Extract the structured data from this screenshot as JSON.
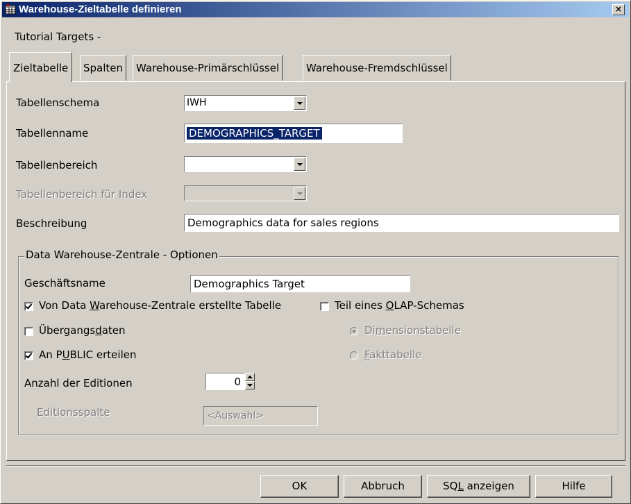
{
  "window": {
    "title": "Warehouse-Zieltabelle definieren",
    "close_glyph": "×",
    "icon": "table-icon"
  },
  "subtitle": "Tutorial Targets -",
  "tabs": [
    {
      "label": "Zieltabelle",
      "active": true
    },
    {
      "label": "Spalten",
      "active": false
    },
    {
      "label": "Warehouse-Primärschlüssel",
      "active": false
    },
    {
      "label": "Warehouse-Fremdschlüssel",
      "active": false
    }
  ],
  "form": {
    "schema_label": "Tabellenschema",
    "schema_value": "IWH",
    "name_label": "Tabellenname",
    "name_value": "DEMOGRAPHICS_TARGET",
    "tablespace_label": "Tabellenbereich",
    "tablespace_value": "",
    "index_tablespace_label": "Tabellenbereich für Index",
    "index_tablespace_value": "",
    "description_label": "Beschreibung",
    "description_value": "Demographics data for sales regions"
  },
  "group": {
    "title": "Data Warehouse-Zentrale - Optionen",
    "business_name_label": "Geschäftsname",
    "business_name_value": "Demographics Target",
    "created_by_center": {
      "pre": "Von Data ",
      "accel": "W",
      "post": "arehouse-Zentrale erstellte Tabelle",
      "checked": true
    },
    "olap_part": {
      "pre": "Teil eines ",
      "accel": "O",
      "post": "LAP-Schemas",
      "checked": false
    },
    "transient": {
      "pre": "Übergangs",
      "accel": "d",
      "post": "aten",
      "checked": false
    },
    "grant_public": {
      "pre": "An P",
      "accel": "U",
      "post": "BLIC erteilen",
      "checked": true
    },
    "dimension_table": {
      "pre": "Di",
      "accel": "m",
      "post": "ensionstabelle",
      "checked": true
    },
    "fact_table": {
      "pre": "",
      "accel": "F",
      "post": "akttabelle",
      "checked": false
    },
    "editions_label": "Anzahl der Editionen",
    "editions_value": "0",
    "edition_column_label": "Editionsspalte",
    "edition_column_value": "<Auswahl>"
  },
  "buttons": {
    "ok": "OK",
    "cancel": "Abbruch",
    "sql": {
      "pre": "SQ",
      "accel": "L",
      "post": " anzeigen"
    },
    "help": "Hilfe"
  }
}
